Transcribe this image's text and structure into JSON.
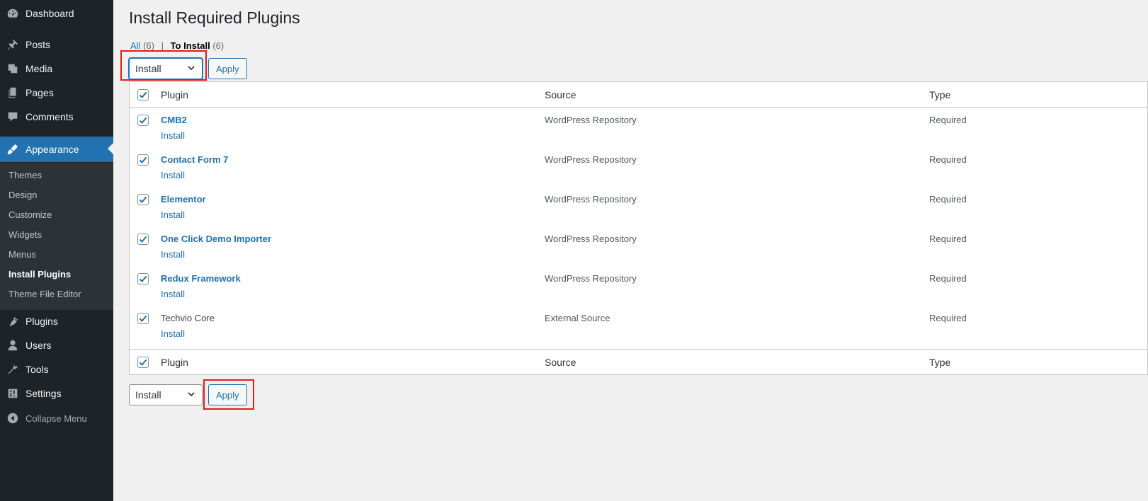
{
  "sidebar": {
    "items": [
      {
        "label": "Dashboard",
        "icon": "dashboard-icon"
      },
      {
        "label": "Posts",
        "icon": "pin-icon"
      },
      {
        "label": "Media",
        "icon": "media-icon"
      },
      {
        "label": "Pages",
        "icon": "pages-icon"
      },
      {
        "label": "Comments",
        "icon": "comment-icon"
      },
      {
        "label": "Appearance",
        "icon": "brush-icon"
      },
      {
        "label": "Plugins",
        "icon": "plugin-icon"
      },
      {
        "label": "Users",
        "icon": "user-icon"
      },
      {
        "label": "Tools",
        "icon": "wrench-icon"
      },
      {
        "label": "Settings",
        "icon": "settings-icon"
      },
      {
        "label": "Collapse Menu",
        "icon": "collapse-icon"
      }
    ],
    "submenu": [
      "Themes",
      "Design",
      "Customize",
      "Widgets",
      "Menus",
      "Install Plugins",
      "Theme File Editor"
    ]
  },
  "page": {
    "title": "Install Required Plugins",
    "views": {
      "all_label": "All",
      "all_count": "(6)",
      "separator": "|",
      "to_install_label": "To Install",
      "to_install_count": "(6)"
    },
    "bulk_top": {
      "select_value": "Install",
      "apply_label": "Apply"
    },
    "bulk_bottom": {
      "select_value": "Install",
      "apply_label": "Apply"
    }
  },
  "table": {
    "columns": [
      "Plugin",
      "Source",
      "Type"
    ],
    "rows": [
      {
        "name": "CMB2",
        "action": "Install",
        "source": "WordPress Repository",
        "type": "Required"
      },
      {
        "name": "Contact Form 7",
        "action": "Install",
        "source": "WordPress Repository",
        "type": "Required"
      },
      {
        "name": "Elementor",
        "action": "Install",
        "source": "WordPress Repository",
        "type": "Required"
      },
      {
        "name": "One Click Demo Importer",
        "action": "Install",
        "source": "WordPress Repository",
        "type": "Required"
      },
      {
        "name": "Redux Framework",
        "action": "Install",
        "source": "WordPress Repository",
        "type": "Required"
      },
      {
        "name": "Techvio Core",
        "action": "Install",
        "source": "External Source",
        "type": "Required"
      }
    ]
  },
  "colors": {
    "sidebar_bg": "#1d2327",
    "submenu_bg": "#2c3338",
    "accent": "#2271b1",
    "highlight": "#e01b1b",
    "page_bg": "#f0f0f1"
  }
}
